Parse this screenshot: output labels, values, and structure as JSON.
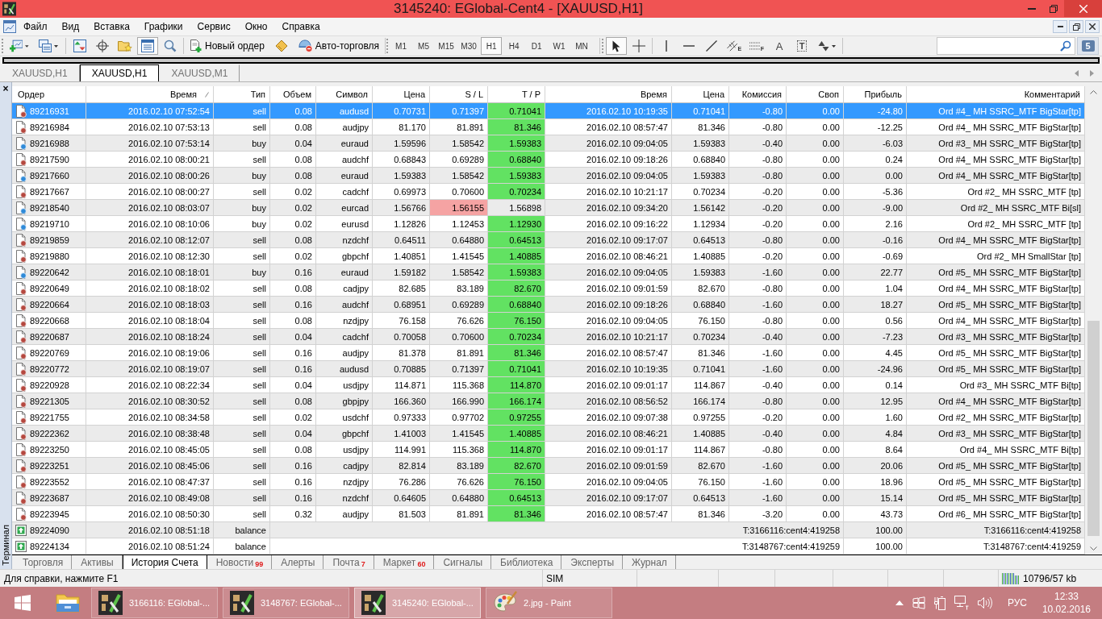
{
  "window": {
    "title": "3145240: EGlobal-Cent4 - [XAUUSD,H1]"
  },
  "menu": {
    "items": [
      "Файл",
      "Вид",
      "Вставка",
      "Графики",
      "Сервис",
      "Окно",
      "Справка"
    ]
  },
  "toolbar": {
    "file_buttons": [
      {
        "kind": "new-chart"
      },
      {
        "kind": "profiles"
      }
    ],
    "view_buttons": [
      {
        "kind": "market-watch",
        "pressed": false
      },
      {
        "kind": "data-window",
        "pressed": false
      },
      {
        "kind": "navigator",
        "pressed": false
      },
      {
        "kind": "terminal",
        "pressed": true
      },
      {
        "kind": "tester",
        "pressed": false
      }
    ],
    "trade_buttons": [
      {
        "kind": "new-order",
        "label": "Новый ордер"
      },
      {
        "kind": "editor"
      },
      {
        "kind": "auto-trading",
        "label": "Авто-торговля"
      }
    ],
    "timeframes": [
      {
        "label": "M1",
        "selected": false
      },
      {
        "label": "M5",
        "selected": false
      },
      {
        "label": "M15",
        "selected": false
      },
      {
        "label": "M30",
        "selected": false
      },
      {
        "label": "H1",
        "selected": true
      },
      {
        "label": "H4",
        "selected": false
      },
      {
        "label": "D1",
        "selected": false
      },
      {
        "label": "W1",
        "selected": false
      },
      {
        "label": "MN",
        "selected": false
      }
    ],
    "cursor_tools": [
      {
        "kind": "cursor",
        "pressed": true
      },
      {
        "kind": "crosshair",
        "pressed": false
      }
    ],
    "object_tools": [
      {
        "kind": "vertical-line"
      },
      {
        "kind": "horizontal-line"
      },
      {
        "kind": "trend-line"
      },
      {
        "kind": "channel",
        "glyph": "E"
      },
      {
        "kind": "fibonacci",
        "glyph": "F"
      },
      {
        "kind": "text",
        "glyph": "A"
      },
      {
        "kind": "label",
        "glyph": "T"
      },
      {
        "kind": "arrows"
      }
    ],
    "messages": "5"
  },
  "chart_tabs": [
    {
      "label": "XAUUSD,H1",
      "selected": false
    },
    {
      "label": "XAUUSD,H1",
      "selected": true
    },
    {
      "label": "XAUUSD,M1",
      "selected": false
    }
  ],
  "terminal": {
    "close": "×",
    "title": "Терминал",
    "columns": [
      {
        "label": "Ордер",
        "sorted": false
      },
      {
        "label": "Время",
        "sorted": true
      },
      {
        "label": "Тип",
        "sorted": false
      },
      {
        "label": "Объем",
        "sorted": false
      },
      {
        "label": "Символ",
        "sorted": false
      },
      {
        "label": "Цена",
        "sorted": false
      },
      {
        "label": "S / L",
        "sorted": false
      },
      {
        "label": "T / P",
        "sorted": false
      },
      {
        "label": "Время",
        "sorted": false
      },
      {
        "label": "Цена",
        "sorted": false
      },
      {
        "label": "Комиссия",
        "sorted": false
      },
      {
        "label": "Своп",
        "sorted": false
      },
      {
        "label": "Прибыль",
        "sorted": false
      },
      {
        "label": "Комментарий",
        "sorted": false
      }
    ],
    "rows": [
      {
        "kind": "sell",
        "selected": true,
        "order": "89216931",
        "time": "2016.02.10 07:52:54",
        "type": "sell",
        "volume": "0.08",
        "symbol": "audusd",
        "price": "0.70731",
        "sl": "0.71397",
        "sl_hit": false,
        "tp": "0.71041",
        "tp_hit": true,
        "close_time": "2016.02.10 10:19:35",
        "close_price": "0.71041",
        "commission": "-0.80",
        "swap": "0.00",
        "profit": "-24.80",
        "comment": "Ord #4_ MH SSRC_MTF BigStar[tp]"
      },
      {
        "kind": "sell",
        "selected": false,
        "order": "89216984",
        "time": "2016.02.10 07:53:13",
        "type": "sell",
        "volume": "0.08",
        "symbol": "audjpy",
        "price": "81.170",
        "sl": "81.891",
        "sl_hit": false,
        "tp": "81.346",
        "tp_hit": true,
        "close_time": "2016.02.10 08:57:47",
        "close_price": "81.346",
        "commission": "-0.80",
        "swap": "0.00",
        "profit": "-12.25",
        "comment": "Ord #4_ MH SSRC_MTF BigStar[tp]"
      },
      {
        "kind": "buy",
        "selected": false,
        "order": "89216988",
        "time": "2016.02.10 07:53:14",
        "type": "buy",
        "volume": "0.04",
        "symbol": "euraud",
        "price": "1.59596",
        "sl": "1.58542",
        "sl_hit": false,
        "tp": "1.59383",
        "tp_hit": true,
        "close_time": "2016.02.10 09:04:05",
        "close_price": "1.59383",
        "commission": "-0.40",
        "swap": "0.00",
        "profit": "-6.03",
        "comment": "Ord #3_ MH SSRC_MTF BigStar[tp]"
      },
      {
        "kind": "sell",
        "selected": false,
        "order": "89217590",
        "time": "2016.02.10 08:00:21",
        "type": "sell",
        "volume": "0.08",
        "symbol": "audchf",
        "price": "0.68843",
        "sl": "0.69289",
        "sl_hit": false,
        "tp": "0.68840",
        "tp_hit": true,
        "close_time": "2016.02.10 09:18:26",
        "close_price": "0.68840",
        "commission": "-0.80",
        "swap": "0.00",
        "profit": "0.24",
        "comment": "Ord #4_ MH SSRC_MTF BigStar[tp]"
      },
      {
        "kind": "buy",
        "selected": false,
        "order": "89217660",
        "time": "2016.02.10 08:00:26",
        "type": "buy",
        "volume": "0.08",
        "symbol": "euraud",
        "price": "1.59383",
        "sl": "1.58542",
        "sl_hit": false,
        "tp": "1.59383",
        "tp_hit": true,
        "close_time": "2016.02.10 09:04:05",
        "close_price": "1.59383",
        "commission": "-0.80",
        "swap": "0.00",
        "profit": "0.00",
        "comment": "Ord #4_ MH SSRC_MTF BigStar[tp]"
      },
      {
        "kind": "sell",
        "selected": false,
        "order": "89217667",
        "time": "2016.02.10 08:00:27",
        "type": "sell",
        "volume": "0.02",
        "symbol": "cadchf",
        "price": "0.69973",
        "sl": "0.70600",
        "sl_hit": false,
        "tp": "0.70234",
        "tp_hit": true,
        "close_time": "2016.02.10 10:21:17",
        "close_price": "0.70234",
        "commission": "-0.20",
        "swap": "0.00",
        "profit": "-5.36",
        "comment": "Ord #2_ MH SSRC_MTF [tp]"
      },
      {
        "kind": "buy",
        "selected": false,
        "order": "89218540",
        "time": "2016.02.10 08:03:07",
        "type": "buy",
        "volume": "0.02",
        "symbol": "eurcad",
        "price": "1.56766",
        "sl": "1.56155",
        "sl_hit": true,
        "tp": "1.56898",
        "tp_hit": false,
        "close_time": "2016.02.10 09:34:20",
        "close_price": "1.56142",
        "commission": "-0.20",
        "swap": "0.00",
        "profit": "-9.00",
        "comment": "Ord #2_ MH SSRC_MTF Bi[sl]"
      },
      {
        "kind": "buy",
        "selected": false,
        "order": "89219710",
        "time": "2016.02.10 08:10:06",
        "type": "buy",
        "volume": "0.02",
        "symbol": "eurusd",
        "price": "1.12826",
        "sl": "1.12453",
        "sl_hit": false,
        "tp": "1.12930",
        "tp_hit": true,
        "close_time": "2016.02.10 09:16:22",
        "close_price": "1.12934",
        "commission": "-0.20",
        "swap": "0.00",
        "profit": "2.16",
        "comment": "Ord #2_ MH SSRC_MTF [tp]"
      },
      {
        "kind": "sell",
        "selected": false,
        "order": "89219859",
        "time": "2016.02.10 08:12:07",
        "type": "sell",
        "volume": "0.08",
        "symbol": "nzdchf",
        "price": "0.64511",
        "sl": "0.64880",
        "sl_hit": false,
        "tp": "0.64513",
        "tp_hit": true,
        "close_time": "2016.02.10 09:17:07",
        "close_price": "0.64513",
        "commission": "-0.80",
        "swap": "0.00",
        "profit": "-0.16",
        "comment": "Ord #4_ MH SSRC_MTF BigStar[tp]"
      },
      {
        "kind": "sell",
        "selected": false,
        "order": "89219880",
        "time": "2016.02.10 08:12:30",
        "type": "sell",
        "volume": "0.02",
        "symbol": "gbpchf",
        "price": "1.40851",
        "sl": "1.41545",
        "sl_hit": false,
        "tp": "1.40885",
        "tp_hit": true,
        "close_time": "2016.02.10 08:46:21",
        "close_price": "1.40885",
        "commission": "-0.20",
        "swap": "0.00",
        "profit": "-0.69",
        "comment": "Ord #2_ MH SmallStar [tp]"
      },
      {
        "kind": "buy",
        "selected": false,
        "order": "89220642",
        "time": "2016.02.10 08:18:01",
        "type": "buy",
        "volume": "0.16",
        "symbol": "euraud",
        "price": "1.59182",
        "sl": "1.58542",
        "sl_hit": false,
        "tp": "1.59383",
        "tp_hit": true,
        "close_time": "2016.02.10 09:04:05",
        "close_price": "1.59383",
        "commission": "-1.60",
        "swap": "0.00",
        "profit": "22.77",
        "comment": "Ord #5_ MH SSRC_MTF BigStar[tp]"
      },
      {
        "kind": "sell",
        "selected": false,
        "order": "89220649",
        "time": "2016.02.10 08:18:02",
        "type": "sell",
        "volume": "0.08",
        "symbol": "cadjpy",
        "price": "82.685",
        "sl": "83.189",
        "sl_hit": false,
        "tp": "82.670",
        "tp_hit": true,
        "close_time": "2016.02.10 09:01:59",
        "close_price": "82.670",
        "commission": "-0.80",
        "swap": "0.00",
        "profit": "1.04",
        "comment": "Ord #4_ MH SSRC_MTF BigStar[tp]"
      },
      {
        "kind": "sell",
        "selected": false,
        "order": "89220664",
        "time": "2016.02.10 08:18:03",
        "type": "sell",
        "volume": "0.16",
        "symbol": "audchf",
        "price": "0.68951",
        "sl": "0.69289",
        "sl_hit": false,
        "tp": "0.68840",
        "tp_hit": true,
        "close_time": "2016.02.10 09:18:26",
        "close_price": "0.68840",
        "commission": "-1.60",
        "swap": "0.00",
        "profit": "18.27",
        "comment": "Ord #5_ MH SSRC_MTF BigStar[tp]"
      },
      {
        "kind": "sell",
        "selected": false,
        "order": "89220668",
        "time": "2016.02.10 08:18:04",
        "type": "sell",
        "volume": "0.08",
        "symbol": "nzdjpy",
        "price": "76.158",
        "sl": "76.626",
        "sl_hit": false,
        "tp": "76.150",
        "tp_hit": true,
        "close_time": "2016.02.10 09:04:05",
        "close_price": "76.150",
        "commission": "-0.80",
        "swap": "0.00",
        "profit": "0.56",
        "comment": "Ord #4_ MH SSRC_MTF BigStar[tp]"
      },
      {
        "kind": "sell",
        "selected": false,
        "order": "89220687",
        "time": "2016.02.10 08:18:24",
        "type": "sell",
        "volume": "0.04",
        "symbol": "cadchf",
        "price": "0.70058",
        "sl": "0.70600",
        "sl_hit": false,
        "tp": "0.70234",
        "tp_hit": true,
        "close_time": "2016.02.10 10:21:17",
        "close_price": "0.70234",
        "commission": "-0.40",
        "swap": "0.00",
        "profit": "-7.23",
        "comment": "Ord #3_ MH SSRC_MTF BigStar[tp]"
      },
      {
        "kind": "sell",
        "selected": false,
        "order": "89220769",
        "time": "2016.02.10 08:19:06",
        "type": "sell",
        "volume": "0.16",
        "symbol": "audjpy",
        "price": "81.378",
        "sl": "81.891",
        "sl_hit": false,
        "tp": "81.346",
        "tp_hit": true,
        "close_time": "2016.02.10 08:57:47",
        "close_price": "81.346",
        "commission": "-1.60",
        "swap": "0.00",
        "profit": "4.45",
        "comment": "Ord #5_ MH SSRC_MTF BigStar[tp]"
      },
      {
        "kind": "sell",
        "selected": false,
        "order": "89220772",
        "time": "2016.02.10 08:19:07",
        "type": "sell",
        "volume": "0.16",
        "symbol": "audusd",
        "price": "0.70885",
        "sl": "0.71397",
        "sl_hit": false,
        "tp": "0.71041",
        "tp_hit": true,
        "close_time": "2016.02.10 10:19:35",
        "close_price": "0.71041",
        "commission": "-1.60",
        "swap": "0.00",
        "profit": "-24.96",
        "comment": "Ord #5_ MH SSRC_MTF BigStar[tp]"
      },
      {
        "kind": "sell",
        "selected": false,
        "order": "89220928",
        "time": "2016.02.10 08:22:34",
        "type": "sell",
        "volume": "0.04",
        "symbol": "usdjpy",
        "price": "114.871",
        "sl": "115.368",
        "sl_hit": false,
        "tp": "114.870",
        "tp_hit": true,
        "close_time": "2016.02.10 09:01:17",
        "close_price": "114.867",
        "commission": "-0.40",
        "swap": "0.00",
        "profit": "0.14",
        "comment": "Ord #3_ MH SSRC_MTF Bi[tp]"
      },
      {
        "kind": "sell",
        "selected": false,
        "order": "89221305",
        "time": "2016.02.10 08:30:52",
        "type": "sell",
        "volume": "0.08",
        "symbol": "gbpjpy",
        "price": "166.360",
        "sl": "166.990",
        "sl_hit": false,
        "tp": "166.174",
        "tp_hit": true,
        "close_time": "2016.02.10 08:56:52",
        "close_price": "166.174",
        "commission": "-0.80",
        "swap": "0.00",
        "profit": "12.95",
        "comment": "Ord #4_ MH SSRC_MTF BigStar[tp]"
      },
      {
        "kind": "sell",
        "selected": false,
        "order": "89221755",
        "time": "2016.02.10 08:34:58",
        "type": "sell",
        "volume": "0.02",
        "symbol": "usdchf",
        "price": "0.97333",
        "sl": "0.97702",
        "sl_hit": false,
        "tp": "0.97255",
        "tp_hit": true,
        "close_time": "2016.02.10 09:07:38",
        "close_price": "0.97255",
        "commission": "-0.20",
        "swap": "0.00",
        "profit": "1.60",
        "comment": "Ord #2_ MH SSRC_MTF BigStar[tp]"
      },
      {
        "kind": "sell",
        "selected": false,
        "order": "89222362",
        "time": "2016.02.10 08:38:48",
        "type": "sell",
        "volume": "0.04",
        "symbol": "gbpchf",
        "price": "1.41003",
        "sl": "1.41545",
        "sl_hit": false,
        "tp": "1.40885",
        "tp_hit": true,
        "close_time": "2016.02.10 08:46:21",
        "close_price": "1.40885",
        "commission": "-0.40",
        "swap": "0.00",
        "profit": "4.84",
        "comment": "Ord #3_ MH SSRC_MTF BigStar[tp]"
      },
      {
        "kind": "sell",
        "selected": false,
        "order": "89223250",
        "time": "2016.02.10 08:45:05",
        "type": "sell",
        "volume": "0.08",
        "symbol": "usdjpy",
        "price": "114.991",
        "sl": "115.368",
        "sl_hit": false,
        "tp": "114.870",
        "tp_hit": true,
        "close_time": "2016.02.10 09:01:17",
        "close_price": "114.867",
        "commission": "-0.80",
        "swap": "0.00",
        "profit": "8.64",
        "comment": "Ord #4_ MH SSRC_MTF Bi[tp]"
      },
      {
        "kind": "sell",
        "selected": false,
        "order": "89223251",
        "time": "2016.02.10 08:45:06",
        "type": "sell",
        "volume": "0.16",
        "symbol": "cadjpy",
        "price": "82.814",
        "sl": "83.189",
        "sl_hit": false,
        "tp": "82.670",
        "tp_hit": true,
        "close_time": "2016.02.10 09:01:59",
        "close_price": "82.670",
        "commission": "-1.60",
        "swap": "0.00",
        "profit": "20.06",
        "comment": "Ord #5_ MH SSRC_MTF BigStar[tp]"
      },
      {
        "kind": "sell",
        "selected": false,
        "order": "89223552",
        "time": "2016.02.10 08:47:37",
        "type": "sell",
        "volume": "0.16",
        "symbol": "nzdjpy",
        "price": "76.286",
        "sl": "76.626",
        "sl_hit": false,
        "tp": "76.150",
        "tp_hit": true,
        "close_time": "2016.02.10 09:04:05",
        "close_price": "76.150",
        "commission": "-1.60",
        "swap": "0.00",
        "profit": "18.96",
        "comment": "Ord #5_ MH SSRC_MTF BigStar[tp]"
      },
      {
        "kind": "sell",
        "selected": false,
        "order": "89223687",
        "time": "2016.02.10 08:49:08",
        "type": "sell",
        "volume": "0.16",
        "symbol": "nzdchf",
        "price": "0.64605",
        "sl": "0.64880",
        "sl_hit": false,
        "tp": "0.64513",
        "tp_hit": true,
        "close_time": "2016.02.10 09:17:07",
        "close_price": "0.64513",
        "commission": "-1.60",
        "swap": "0.00",
        "profit": "15.14",
        "comment": "Ord #5_ MH SSRC_MTF BigStar[tp]"
      },
      {
        "kind": "sell",
        "selected": false,
        "order": "89223945",
        "time": "2016.02.10 08:50:30",
        "type": "sell",
        "volume": "0.32",
        "symbol": "audjpy",
        "price": "81.503",
        "sl": "81.891",
        "sl_hit": false,
        "tp": "81.346",
        "tp_hit": true,
        "close_time": "2016.02.10 08:57:47",
        "close_price": "81.346",
        "commission": "-3.20",
        "swap": "0.00",
        "profit": "43.73",
        "comment": "Ord #6_ MH SSRC_MTF BigStar[tp]"
      },
      {
        "kind": "balance",
        "selected": false,
        "order": "89224090",
        "time": "2016.02.10 08:51:18",
        "type": "balance",
        "description": "T:3166116:cent4:419258",
        "profit": "100.00",
        "comment": "T:3166116:cent4:419258"
      },
      {
        "kind": "balance",
        "selected": false,
        "order": "89224134",
        "time": "2016.02.10 08:51:24",
        "type": "balance",
        "description": "T:3148767:cent4:419259",
        "profit": "100.00",
        "comment": "T:3148767:cent4:419259"
      }
    ],
    "tabs": [
      {
        "label": "Торговля",
        "selected": false
      },
      {
        "label": "Активы",
        "selected": false
      },
      {
        "label": "История Счета",
        "selected": true
      },
      {
        "label": "Новости",
        "badge": "99",
        "selected": false
      },
      {
        "label": "Алерты",
        "selected": false
      },
      {
        "label": "Почта",
        "badge": "7",
        "selected": false
      },
      {
        "label": "Маркет",
        "badge": "60",
        "selected": false
      },
      {
        "label": "Сигналы",
        "selected": false
      },
      {
        "label": "Библиотека",
        "selected": false
      },
      {
        "label": "Эксперты",
        "selected": false
      },
      {
        "label": "Журнал",
        "selected": false
      }
    ]
  },
  "status_bar": {
    "help": "Для справки, нажмите F1",
    "profile": "SIM",
    "traffic": "10796/57 kb"
  },
  "taskbar": {
    "tasks": [
      {
        "kind": "terminal",
        "label": "3166116: EGlobal-...",
        "active": false
      },
      {
        "kind": "terminal",
        "label": "3148767: EGlobal-...",
        "active": false
      },
      {
        "kind": "terminal",
        "label": "3145240: EGlobal-...",
        "active": true
      },
      {
        "kind": "paint",
        "label": "2.jpg - Paint",
        "active": false
      }
    ],
    "language": "РУС",
    "time": "12:33",
    "date": "10.02.2016"
  }
}
